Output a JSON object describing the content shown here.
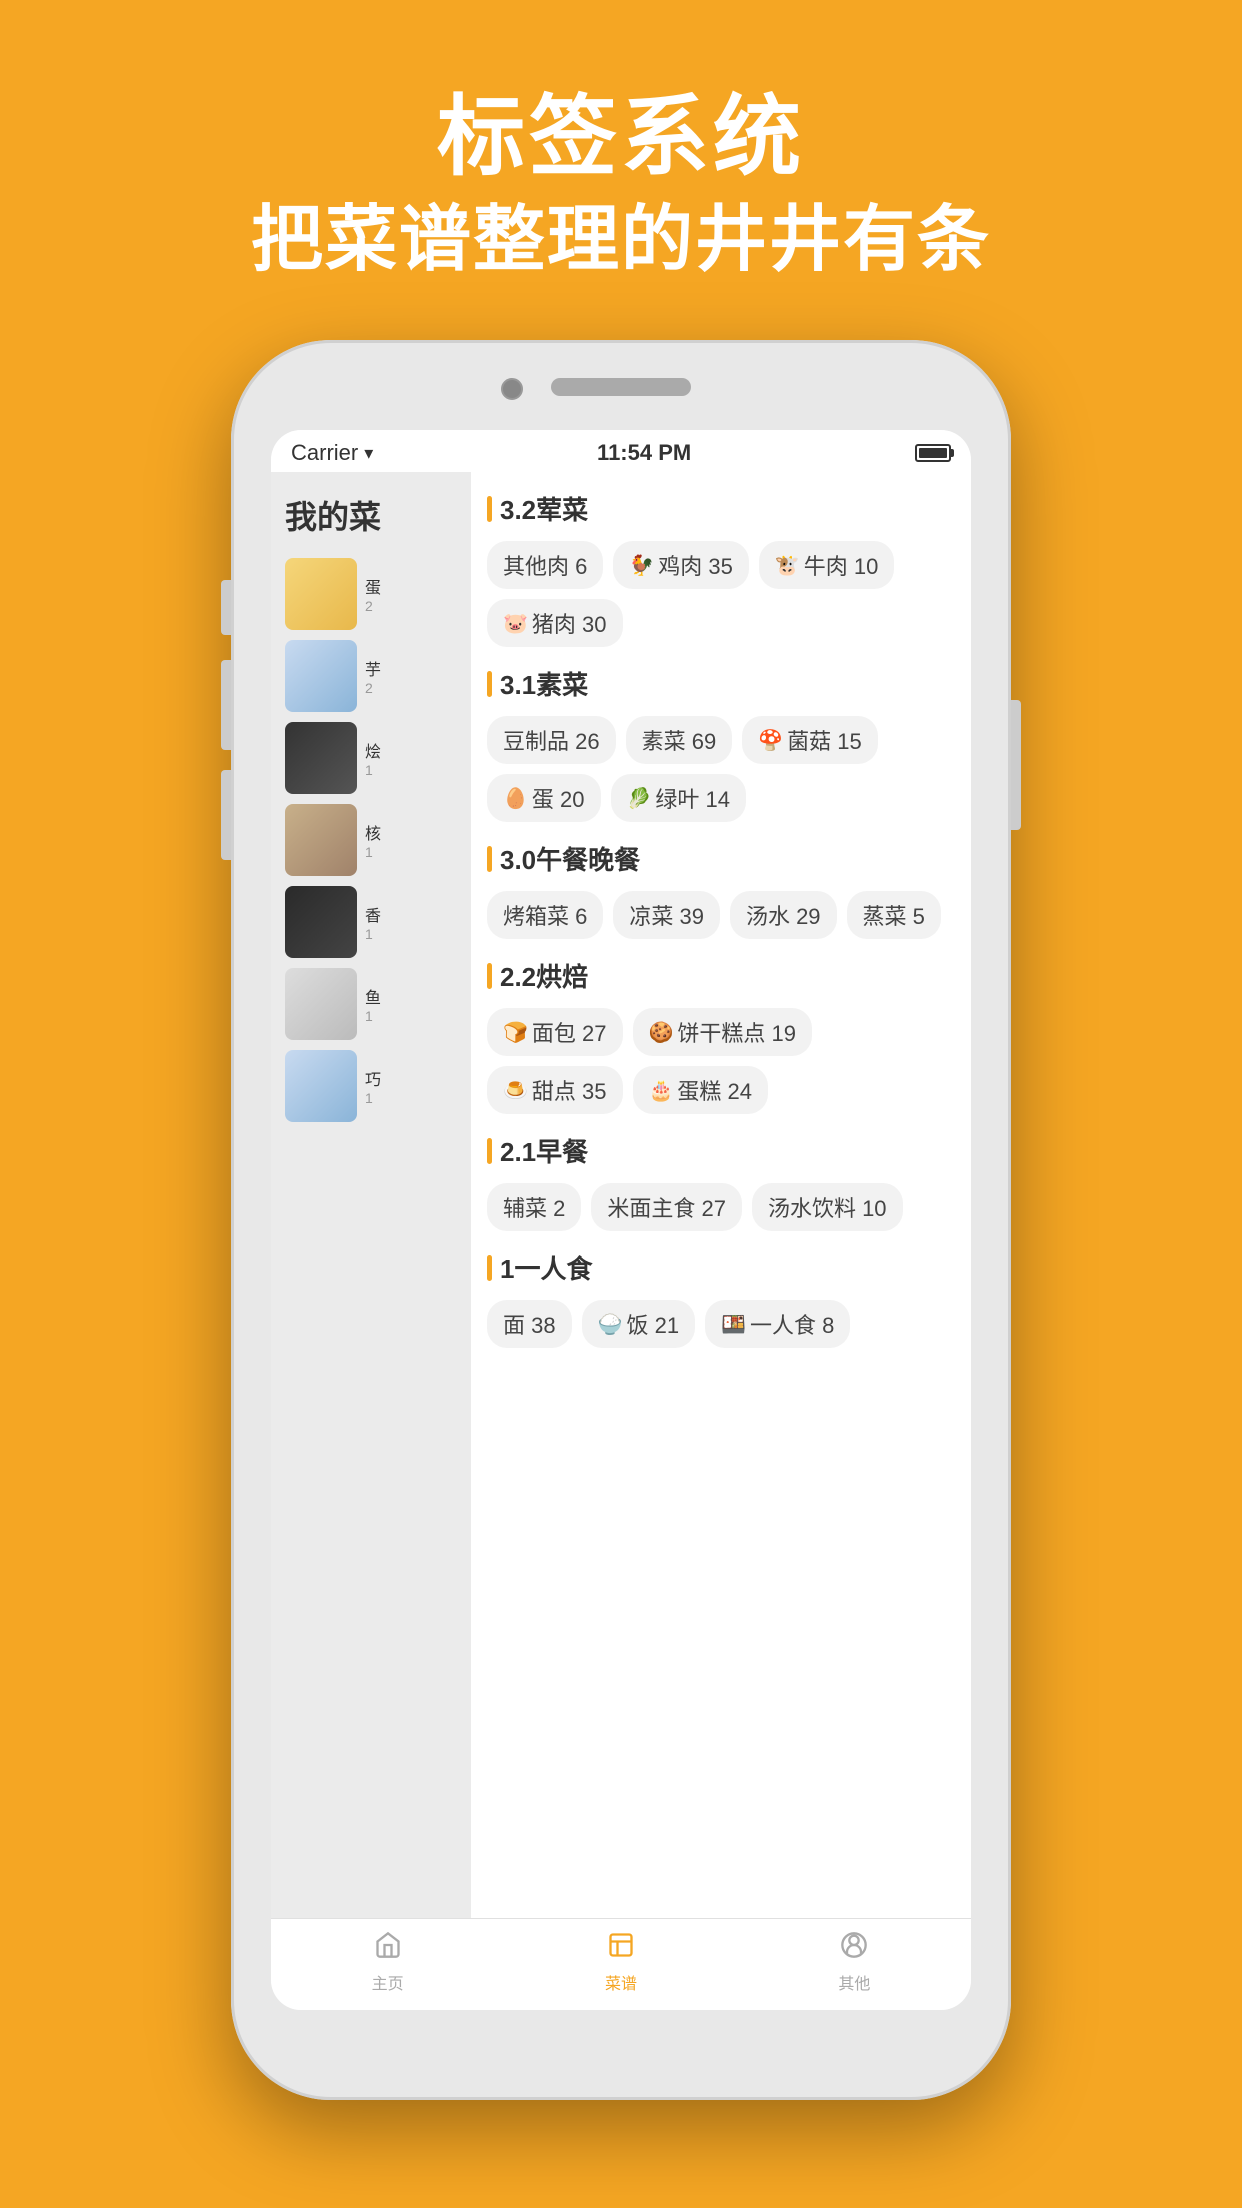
{
  "header": {
    "line1": "标签系统",
    "line2": "把菜谱整理的井井有条"
  },
  "statusBar": {
    "carrier": "Carrier",
    "time": "11:54 PM"
  },
  "sidebar": {
    "title": "我的菜",
    "recipes": [
      {
        "id": 1,
        "thumbClass": "thumb-1",
        "name": "蛋",
        "meta": "2"
      },
      {
        "id": 2,
        "thumbClass": "thumb-2",
        "name": "芋",
        "meta": "2"
      },
      {
        "id": 3,
        "thumbClass": "thumb-3",
        "name": "烩",
        "meta": "1"
      },
      {
        "id": 4,
        "thumbClass": "thumb-4",
        "name": "核",
        "meta": "1"
      },
      {
        "id": 5,
        "thumbClass": "thumb-5",
        "name": "香",
        "meta": "1"
      },
      {
        "id": 6,
        "thumbClass": "thumb-6",
        "name": "鱼",
        "meta": "1"
      },
      {
        "id": 7,
        "thumbClass": "thumb-2",
        "name": "巧",
        "meta": "1"
      }
    ]
  },
  "categories": [
    {
      "id": "3.2",
      "title": "3.2荤菜",
      "tags": [
        {
          "label": "其他肉 6",
          "emoji": ""
        },
        {
          "label": "鸡肉 35",
          "emoji": "🐓"
        },
        {
          "label": "牛肉 10",
          "emoji": "🐮"
        },
        {
          "label": "猪肉 30",
          "emoji": "🐷"
        }
      ]
    },
    {
      "id": "3.1",
      "title": "3.1素菜",
      "tags": [
        {
          "label": "豆制品 26",
          "emoji": ""
        },
        {
          "label": "素菜 69",
          "emoji": ""
        },
        {
          "label": "菌菇 15",
          "emoji": "🍄"
        },
        {
          "label": "蛋 20",
          "emoji": "🥚"
        },
        {
          "label": "绿叶 14",
          "emoji": "🥬"
        }
      ]
    },
    {
      "id": "3.0",
      "title": "3.0午餐晚餐",
      "tags": [
        {
          "label": "烤箱菜 6",
          "emoji": ""
        },
        {
          "label": "凉菜 39",
          "emoji": ""
        },
        {
          "label": "汤水 29",
          "emoji": ""
        },
        {
          "label": "蒸菜 5",
          "emoji": ""
        }
      ]
    },
    {
      "id": "2.2",
      "title": "2.2烘焙",
      "tags": [
        {
          "label": "面包 27",
          "emoji": "🍞"
        },
        {
          "label": "饼干糕点 19",
          "emoji": "🍪"
        },
        {
          "label": "甜点 35",
          "emoji": "🍮"
        },
        {
          "label": "蛋糕 24",
          "emoji": "🎂"
        }
      ]
    },
    {
      "id": "2.1",
      "title": "2.1早餐",
      "tags": [
        {
          "label": "辅菜 2",
          "emoji": ""
        },
        {
          "label": "米面主食 27",
          "emoji": ""
        },
        {
          "label": "汤水饮料 10",
          "emoji": ""
        }
      ]
    },
    {
      "id": "1",
      "title": "1一人食",
      "tags": [
        {
          "label": "面 38",
          "emoji": ""
        },
        {
          "label": "饭 21",
          "emoji": "🍚"
        },
        {
          "label": "一人食 8",
          "emoji": "🍱"
        }
      ]
    }
  ],
  "tabs": [
    {
      "id": "home",
      "label": "主页",
      "icon": "🏠",
      "active": false
    },
    {
      "id": "recipes",
      "label": "菜谱",
      "icon": "📋",
      "active": true
    },
    {
      "id": "other",
      "label": "其他",
      "icon": "👤",
      "active": false
    }
  ]
}
